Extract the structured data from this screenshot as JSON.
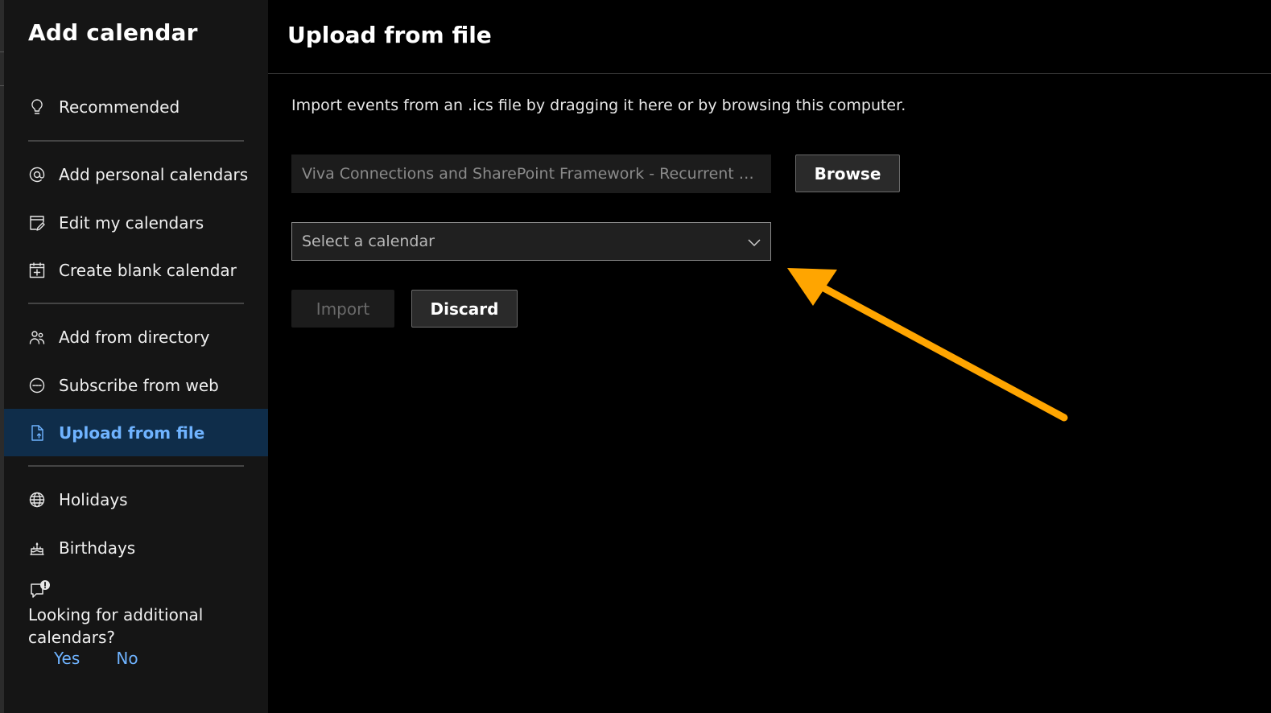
{
  "sidebar": {
    "title": "Add calendar",
    "items": [
      {
        "label": "Recommended",
        "icon": "lightbulb-icon"
      },
      {
        "label": "Add personal calendars",
        "icon": "at-sign-icon"
      },
      {
        "label": "Edit my calendars",
        "icon": "edit-calendar-icon"
      },
      {
        "label": "Create blank calendar",
        "icon": "calendar-add-icon"
      },
      {
        "label": "Add from directory",
        "icon": "people-icon"
      },
      {
        "label": "Subscribe from web",
        "icon": "link-circle-icon"
      },
      {
        "label": "Upload from file",
        "icon": "file-upload-icon",
        "active": true
      },
      {
        "label": "Holidays",
        "icon": "globe-icon"
      },
      {
        "label": "Birthdays",
        "icon": "cake-icon"
      }
    ],
    "feedback": {
      "question": "Looking for additional calendars?",
      "yes": "Yes",
      "no": "No"
    }
  },
  "main": {
    "title": "Upload from file",
    "description": "Import events from an .ics file by dragging it here or by browsing this computer.",
    "file_name": "Viva Connections and SharePoint Framework - Recurrent meeting.ics",
    "browse_label": "Browse",
    "select": {
      "placeholder": "Select a calendar"
    },
    "import_label": "Import",
    "discard_label": "Discard"
  },
  "colors": {
    "accent": "#6fb3ff",
    "active_bg": "#0f2d4a",
    "annotation_arrow": "#ffa500"
  }
}
